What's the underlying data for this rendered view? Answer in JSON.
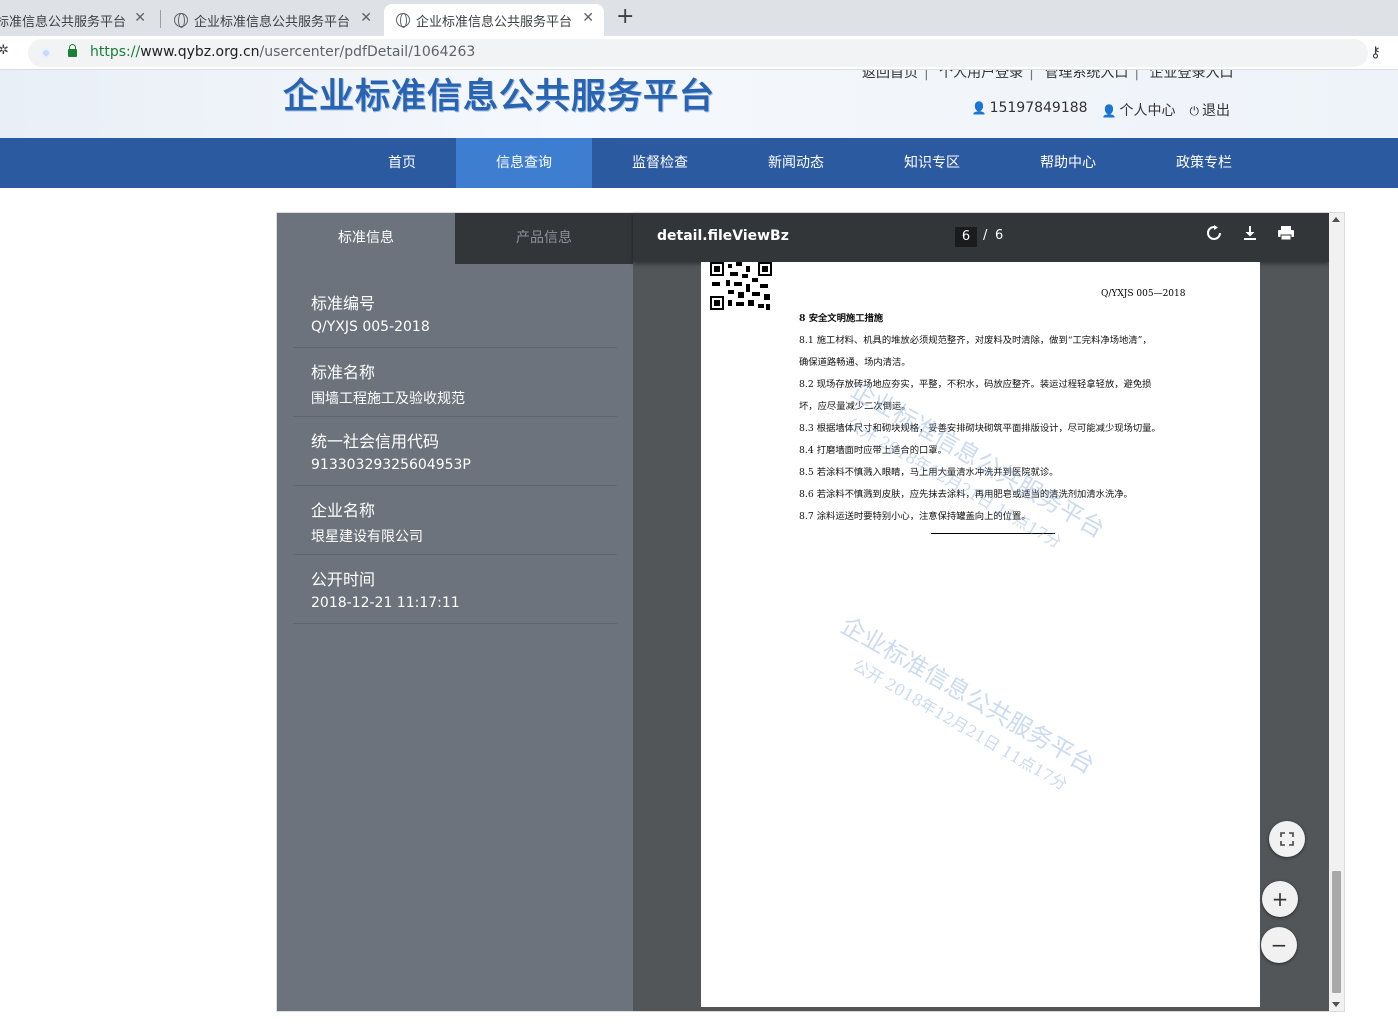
{
  "browser": {
    "tabs": [
      {
        "title": "标准信息公共服务平台"
      },
      {
        "title": "企业标准信息公共服务平台"
      },
      {
        "title": "企业标准信息公共服务平台"
      }
    ],
    "close_glyph": "✕",
    "url_scheme": "https://",
    "url_host": "www.qybz.org.cn",
    "url_path": "/usercenter/pdfDetail/1064263"
  },
  "header": {
    "logo": "企业标准信息公共服务平台",
    "top_links": [
      "返回首页",
      "个人用户登录",
      "管理系统入口",
      "企业登录入口"
    ],
    "phone": "15197849188",
    "user_center": "个人中心",
    "logout": "退出"
  },
  "nav": {
    "items": [
      "首页",
      "信息查询",
      "监督检查",
      "新闻动态",
      "知识专区",
      "帮助中心",
      "政策专栏"
    ],
    "active_index": 1
  },
  "sidebar": {
    "tabs": [
      "标准信息",
      "产品信息"
    ],
    "items": [
      {
        "label": "标准编号",
        "value": "Q/YXJS 005-2018"
      },
      {
        "label": "标准名称",
        "value": "围墙工程施工及验收规范"
      },
      {
        "label": "统一社会信用代码",
        "value": "91330329325604953P"
      },
      {
        "label": "企业名称",
        "value": "垠星建设有限公司"
      },
      {
        "label": "公开时间",
        "value": "2018-12-21 11:17:11"
      }
    ]
  },
  "viewer": {
    "title": "detail.fileViewBz",
    "current_page": "6",
    "separator": "/",
    "total_pages": "6"
  },
  "document": {
    "code": "Q/YXJS 005—2018",
    "lines": [
      "8  安全文明施工措施",
      "8.1  施工材料、机具的堆放必须规范整齐，对废料及时清除，做到“工完料净场地清”，",
      "确保道路畅通、场内清洁。",
      "8.2  现场存放砖场地应夯实，平整，不积水，码放应整齐。装运过程轻拿轻放，避免损",
      "坏，应尽量减少二次倒运。",
      "8.3  根据墙体尺寸和砌块规格，妥善安排砌块砌筑平面排版设计，尽可能减少现场切量。",
      "8.4  打磨墙面时应带上适合的口罩。",
      "8.5  若涂料不慎溅入眼睛，马上用大量清水冲洗并到医院就诊。",
      "8.6 若涂料不慎溅到皮肤，应先抹去涂料，再用肥皂或适当的清洗剂加清水洗净。",
      "8.7  涂料运送时要特别小心，注意保持罐盖向上的位置。"
    ],
    "watermark_title": "企业标准信息公共服务平台",
    "watermark_sub": "公开    2018年12月21日 11点17分"
  }
}
